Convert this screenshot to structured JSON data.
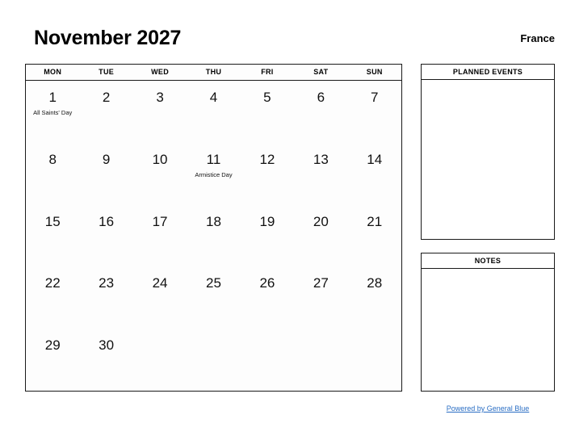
{
  "header": {
    "title": "November 2027",
    "country": "France"
  },
  "calendar": {
    "weekdays": [
      "MON",
      "TUE",
      "WED",
      "THU",
      "FRI",
      "SAT",
      "SUN"
    ],
    "weeks": [
      [
        {
          "day": "1",
          "holiday": "All Saints' Day"
        },
        {
          "day": "2",
          "holiday": ""
        },
        {
          "day": "3",
          "holiday": ""
        },
        {
          "day": "4",
          "holiday": ""
        },
        {
          "day": "5",
          "holiday": ""
        },
        {
          "day": "6",
          "holiday": ""
        },
        {
          "day": "7",
          "holiday": ""
        }
      ],
      [
        {
          "day": "8",
          "holiday": ""
        },
        {
          "day": "9",
          "holiday": ""
        },
        {
          "day": "10",
          "holiday": ""
        },
        {
          "day": "11",
          "holiday": "Armistice Day"
        },
        {
          "day": "12",
          "holiday": ""
        },
        {
          "day": "13",
          "holiday": ""
        },
        {
          "day": "14",
          "holiday": ""
        }
      ],
      [
        {
          "day": "15",
          "holiday": ""
        },
        {
          "day": "16",
          "holiday": ""
        },
        {
          "day": "17",
          "holiday": ""
        },
        {
          "day": "18",
          "holiday": ""
        },
        {
          "day": "19",
          "holiday": ""
        },
        {
          "day": "20",
          "holiday": ""
        },
        {
          "day": "21",
          "holiday": ""
        }
      ],
      [
        {
          "day": "22",
          "holiday": ""
        },
        {
          "day": "23",
          "holiday": ""
        },
        {
          "day": "24",
          "holiday": ""
        },
        {
          "day": "25",
          "holiday": ""
        },
        {
          "day": "26",
          "holiday": ""
        },
        {
          "day": "27",
          "holiday": ""
        },
        {
          "day": "28",
          "holiday": ""
        }
      ],
      [
        {
          "day": "29",
          "holiday": ""
        },
        {
          "day": "30",
          "holiday": ""
        },
        {
          "day": "",
          "holiday": ""
        },
        {
          "day": "",
          "holiday": ""
        },
        {
          "day": "",
          "holiday": ""
        },
        {
          "day": "",
          "holiday": ""
        },
        {
          "day": "",
          "holiday": ""
        }
      ]
    ]
  },
  "panels": {
    "events": {
      "title": "PLANNED EVENTS",
      "content": ""
    },
    "notes": {
      "title": "NOTES",
      "content": ""
    }
  },
  "footer": {
    "link_label": "Powered by General Blue"
  },
  "colors": {
    "border": "#1a1a1a",
    "text": "#000000",
    "link": "#2a6ec4",
    "background": "#ffffff"
  }
}
